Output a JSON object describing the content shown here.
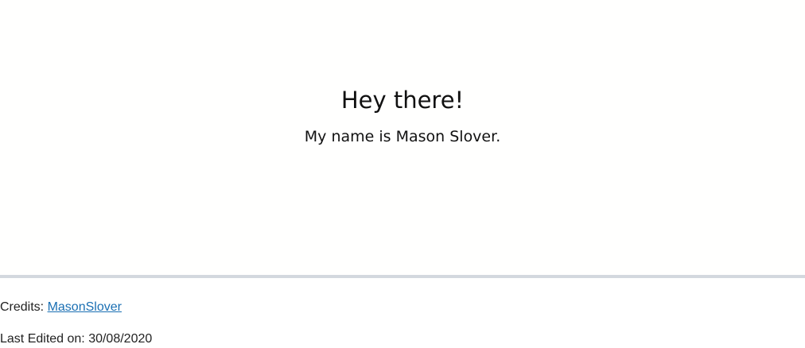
{
  "hero": {
    "title": "Hey there!",
    "subtitle": "My name is Mason Slover."
  },
  "footer": {
    "credits_label": "Credits: ",
    "credits_link_text": "MasonSlover",
    "last_edited_label": "Last Edited on: ",
    "last_edited_date": "30/08/2020"
  },
  "colors": {
    "link": "#1a6fb3",
    "divider": "#d3d8de",
    "text": "#111111"
  }
}
